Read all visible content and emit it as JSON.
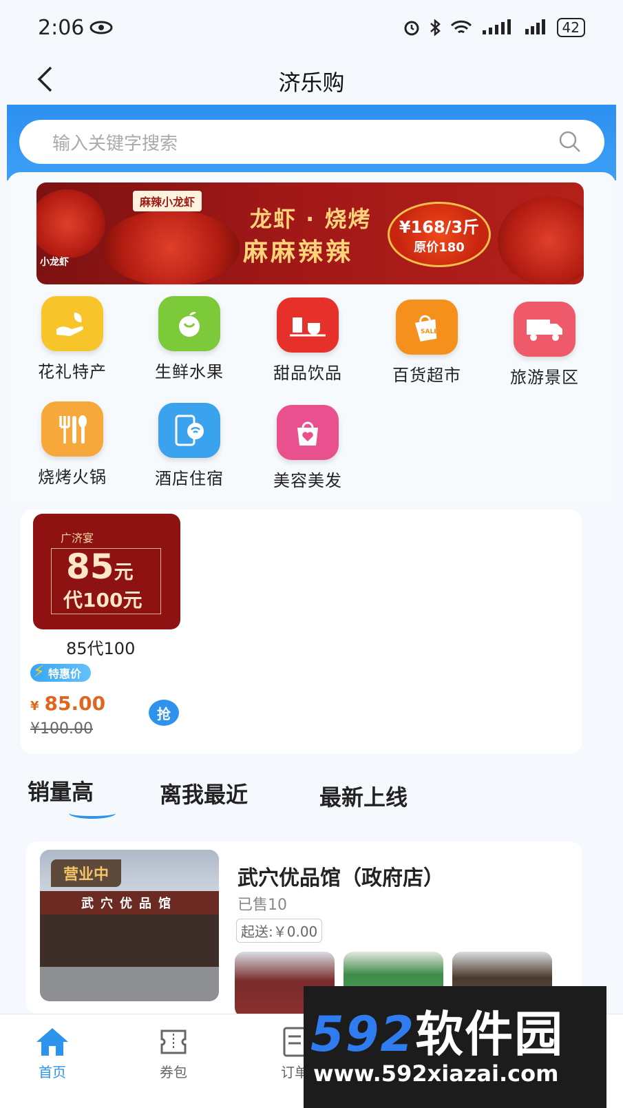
{
  "status": {
    "time": "2:06",
    "battery": "42"
  },
  "header": {
    "title": "济乐购",
    "back_icon": "chevron-left-icon"
  },
  "search": {
    "placeholder": "输入关键字搜索",
    "icon": "search-icon"
  },
  "banner": {
    "tag": "麻辣小龙虾",
    "headline": "龙虾 · 烧烤",
    "headline2": "麻麻辣辣",
    "price": "¥168/3斤",
    "original": "原价180",
    "logo": "小龙虾"
  },
  "categories": [
    {
      "label": "花礼特产",
      "icon": "gift-hand-icon",
      "color": "#f7c52a"
    },
    {
      "label": "生鲜水果",
      "icon": "fruit-icon",
      "color": "#7cc93a"
    },
    {
      "label": "甜品饮品",
      "icon": "drink-icon",
      "color": "#e6312a"
    },
    {
      "label": "百货超市",
      "icon": "shopping-bag-sale-icon",
      "color": "#f5901d"
    },
    {
      "label": "旅游景区",
      "icon": "truck-icon",
      "color": "#ee5a6a"
    },
    {
      "label": "烧烤火锅",
      "icon": "cutlery-icon",
      "color": "#f6a93a"
    },
    {
      "label": "酒店住宿",
      "icon": "phone-wifi-icon",
      "color": "#3ba3ee"
    },
    {
      "label": "美容美发",
      "icon": "heart-bag-icon",
      "color": "#e9508e"
    }
  ],
  "deal": {
    "coupon_brand": "广济宴",
    "coupon_value": "85",
    "coupon_unit": "元",
    "coupon_sub": "代100元",
    "title": "85代100",
    "tag": "特惠价",
    "price_symbol": "¥",
    "price": "85.00",
    "original_price": "¥100.00",
    "grab_label": "抢"
  },
  "sort_tabs": [
    "销量高",
    "离我最近",
    "最新上线"
  ],
  "store": {
    "badge": "营业中",
    "sign": "武穴优品馆",
    "name": "武穴优品馆（政府店）",
    "sold": "已售10",
    "min_delivery": "起送:￥0.00"
  },
  "tabbar": [
    {
      "label": "首页",
      "icon": "home-icon",
      "active": true
    },
    {
      "label": "券包",
      "icon": "coupon-icon",
      "active": false
    },
    {
      "label": "订单",
      "icon": "order-icon",
      "active": false
    }
  ],
  "watermark": {
    "big_num": "592",
    "big_cn": "软件园",
    "url": "www.592xiazai.com"
  },
  "colors": {
    "accent": "#2d93ec",
    "price": "#e0661e",
    "coupon_bg": "#8e1212"
  }
}
